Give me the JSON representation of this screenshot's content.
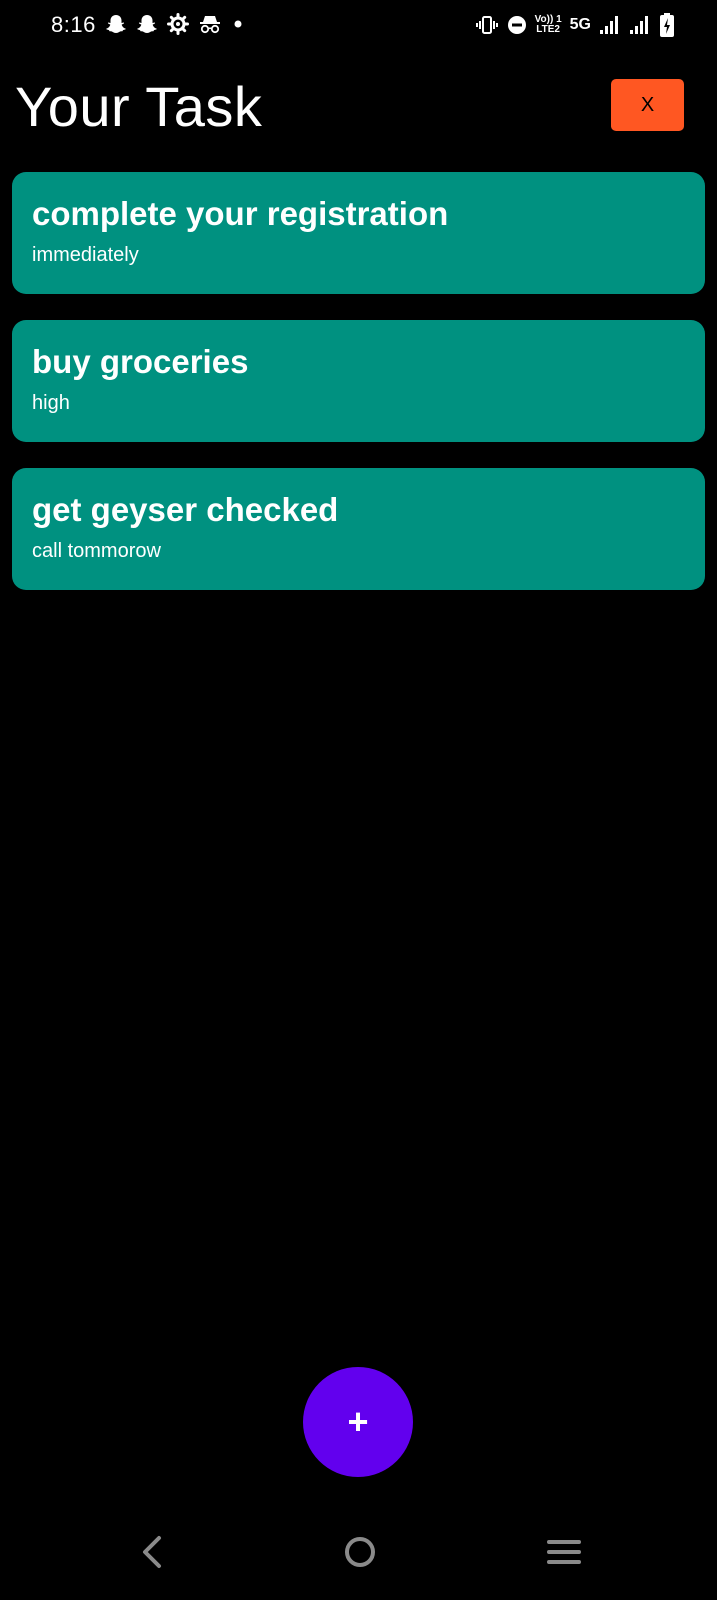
{
  "status_bar": {
    "time": "8:16",
    "left_icons": [
      "snapchat-icon",
      "snapchat-icon",
      "settings-gear-icon",
      "incognito-icon",
      "notification-dot-icon"
    ],
    "volte_label_top": "Vo)) 1",
    "volte_label_bottom": "LTE2",
    "network_label": "5G",
    "right_icons": [
      "vibrate-icon",
      "do-not-disturb-icon",
      "volte-icon",
      "signal-icon",
      "signal-icon",
      "battery-charging-icon"
    ]
  },
  "header": {
    "title": "Your Task",
    "close_label": "X"
  },
  "tasks": [
    {
      "title": "complete your registration",
      "subtitle": "immediately"
    },
    {
      "title": "buy groceries",
      "subtitle": "high"
    },
    {
      "title": "get geyser checked",
      "subtitle": "call tommorow"
    }
  ],
  "fab": {
    "label": "+"
  },
  "nav_bar": {
    "icons": [
      "back-icon",
      "home-icon",
      "recents-menu-icon"
    ]
  },
  "colors": {
    "background": "#000000",
    "task_card": "#009180",
    "close_button": "#ff5722",
    "fab": "#6200ee",
    "text": "#ffffff"
  }
}
